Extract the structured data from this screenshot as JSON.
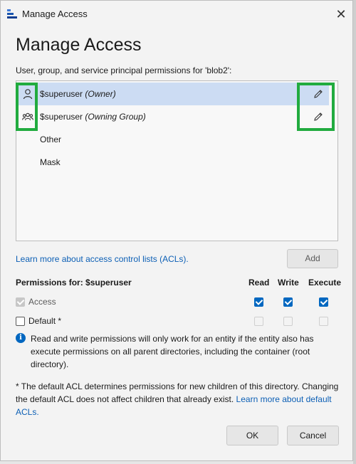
{
  "window": {
    "title": "Manage Access",
    "close_glyph": "✕"
  },
  "heading": "Manage Access",
  "description": "User, group, and service principal permissions for 'blob2':",
  "entries": [
    {
      "name": "$superuser",
      "role": "(Owner)",
      "icon": "user-icon",
      "selected": true
    },
    {
      "name": "$superuser",
      "role": "(Owning Group)",
      "icon": "group-icon",
      "selected": false
    },
    {
      "name": "Other",
      "role": "",
      "icon": "",
      "selected": false
    },
    {
      "name": "Mask",
      "role": "",
      "icon": "",
      "selected": false
    }
  ],
  "acl_link": "Learn more about access control lists (ACLs).",
  "add_button": "Add",
  "permissions": {
    "title": "Permissions for: $superuser",
    "columns": [
      "Read",
      "Write",
      "Execute"
    ],
    "rows": [
      {
        "label": "Access",
        "checked": true,
        "disabled": true,
        "read": true,
        "write": true,
        "execute": true
      },
      {
        "label": "Default *",
        "checked": false,
        "disabled": false,
        "read": false,
        "write": false,
        "execute": false
      }
    ]
  },
  "info_text": "Read and write permissions will only work for an entity if the entity also has execute permissions on all parent directories, including the container (root directory).",
  "note": {
    "text": "* The default ACL determines permissions for new children of this directory. Changing the default ACL does not affect children that already exist.",
    "link": "Learn more about default ACLs."
  },
  "buttons": {
    "ok": "OK",
    "cancel": "Cancel"
  },
  "colors": {
    "accent": "#0067c0",
    "highlight_box": "#21ab3f",
    "selected_row": "#ccdcf3",
    "link": "#0c5fb5"
  }
}
